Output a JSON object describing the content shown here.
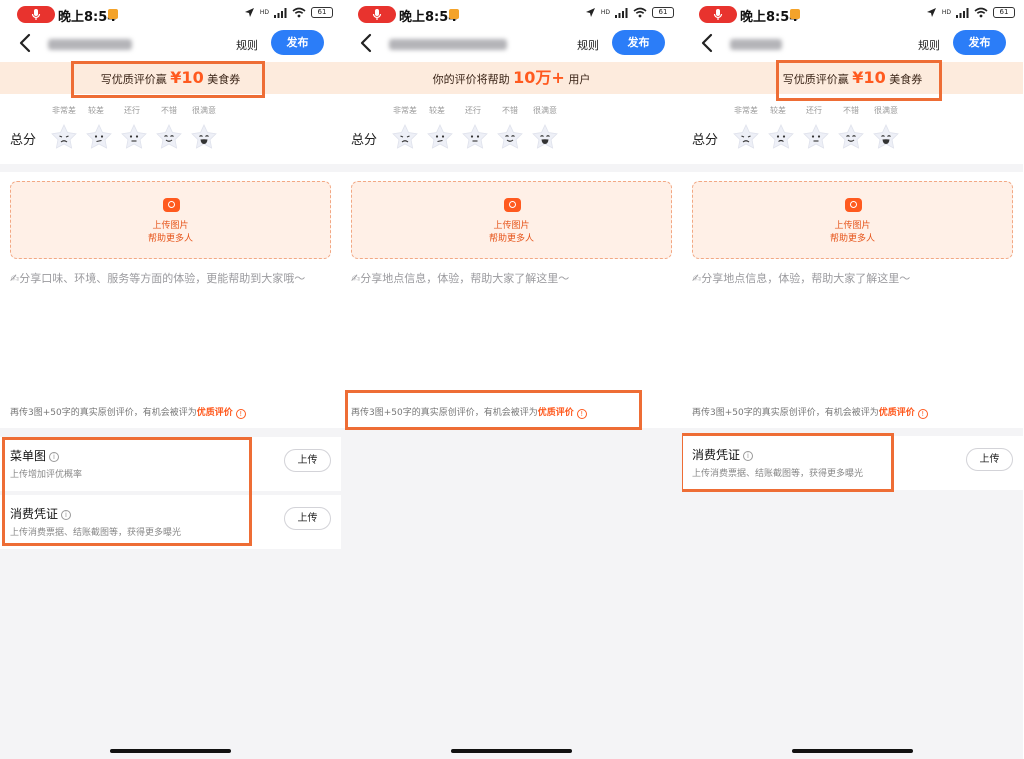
{
  "status_bar": {
    "time": "晚上8:54",
    "network_tag": "HD",
    "battery": "61"
  },
  "nav": {
    "rules_label": "规则",
    "publish_label": "发布"
  },
  "rating": {
    "score_label": "总分",
    "levels": [
      "非常差",
      "较差",
      "还行",
      "不错",
      "很满意"
    ]
  },
  "upload": {
    "line1": "上传图片",
    "line2": "帮助更多人"
  },
  "hint": {
    "prefix": "再传3图+50字的真实原创评价，有机会被评为",
    "emphasis": "优质评价",
    "icon": "!"
  },
  "upload_button_label": "上传",
  "panels": [
    {
      "banner": {
        "prefix": "写优质评价赢",
        "amount": "¥10",
        "suffix": "美食券"
      },
      "prompt": "✍分享口味、环境、服务等方面的体验，更能帮助到大家哦～",
      "sections": [
        {
          "title": "菜单图",
          "subtitle": "上传增加评优概率"
        },
        {
          "title": "消费凭证",
          "subtitle": "上传消费票据、结账截图等，获得更多曝光"
        }
      ]
    },
    {
      "banner": {
        "prefix": "你的评价将帮助",
        "amount": "10万+",
        "suffix": "用户"
      },
      "prompt": "✍分享地点信息，体验，帮助大家了解这里～",
      "sections": []
    },
    {
      "banner": {
        "prefix": "写优质评价赢",
        "amount": "¥10",
        "suffix": "美食券"
      },
      "prompt": "✍分享地点信息，体验，帮助大家了解这里～",
      "sections": [
        {
          "title": "消费凭证",
          "subtitle": "上传消费票据、结账截图等，获得更多曝光"
        }
      ]
    }
  ],
  "colors": {
    "accent_orange": "#ff5a1f",
    "publish_blue": "#2b7df8",
    "banner_bg": "#fdebdd",
    "annotation_box": "#ee6d35",
    "record_red": "#e8332e"
  },
  "icons": [
    "mic-icon",
    "location-arrow-icon",
    "signal-icon",
    "wifi-icon",
    "battery-icon",
    "back-chevron-icon",
    "camera-icon",
    "info-icon",
    "star-face-icon"
  ]
}
